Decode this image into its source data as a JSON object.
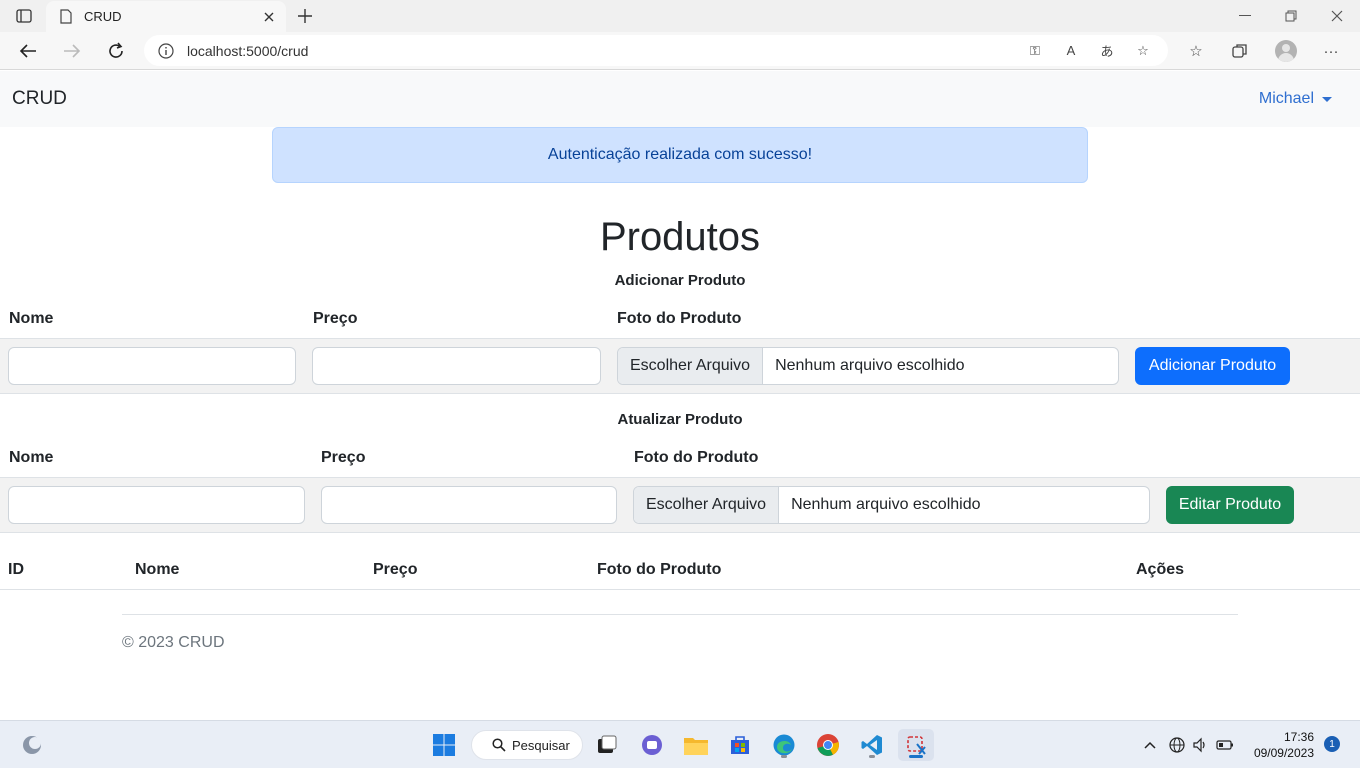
{
  "browser": {
    "tab_title": "CRUD",
    "url": "localhost:5000/crud"
  },
  "navbar": {
    "brand": "CRUD",
    "user": "Michael"
  },
  "alert": {
    "message": "Autenticação realizada com sucesso!"
  },
  "page": {
    "title": "Produtos"
  },
  "add_form": {
    "heading": "Adicionar Produto",
    "col_nome": "Nome",
    "col_preco": "Preço",
    "col_foto": "Foto do Produto",
    "file_button": "Escolher Arquivo",
    "file_status": "Nenhum arquivo escolhido",
    "submit": "Adicionar Produto"
  },
  "edit_form": {
    "heading": "Atualizar Produto",
    "col_nome": "Nome",
    "col_preco": "Preço",
    "col_foto": "Foto do Produto",
    "file_button": "Escolher Arquivo",
    "file_status": "Nenhum arquivo escolhido",
    "submit": "Editar Produto"
  },
  "products_table": {
    "columns": [
      "ID",
      "Nome",
      "Preço",
      "Foto do Produto",
      "Ações"
    ],
    "rows": []
  },
  "footer": {
    "text": "© 2023 CRUD"
  },
  "taskbar": {
    "search_label": "Pesquisar",
    "time": "17:36",
    "date": "09/09/2023",
    "notifications": "1"
  },
  "colors": {
    "primary": "#0d6efd",
    "success": "#198754",
    "alert_bg": "#cfe2ff",
    "link": "#2f6fd0"
  }
}
